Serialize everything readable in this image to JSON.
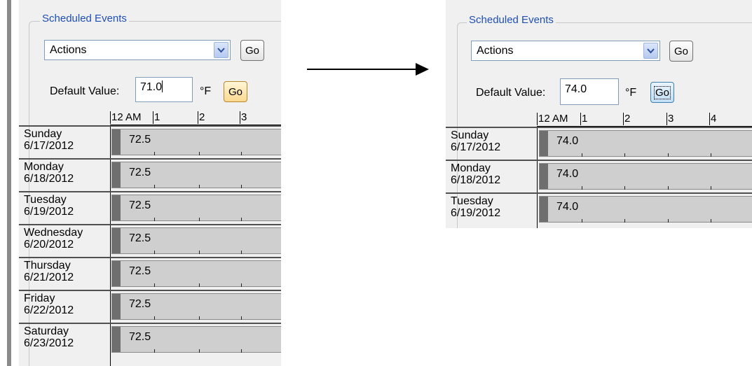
{
  "left_panel": {
    "group_title": "Scheduled Events",
    "actions_select_value": "Actions",
    "go_top_label": "Go",
    "default_value_label": "Default Value:",
    "default_value_input": "71.0",
    "unit_label": "°F",
    "go_default_label": "Go",
    "hour_ticks": [
      "12 AM",
      "1",
      "2",
      "3"
    ],
    "rows": [
      {
        "day": "Sunday",
        "date": "6/17/2012",
        "value": "72.5"
      },
      {
        "day": "Monday",
        "date": "6/18/2012",
        "value": "72.5"
      },
      {
        "day": "Tuesday",
        "date": "6/19/2012",
        "value": "72.5"
      },
      {
        "day": "Wednesday",
        "date": "6/20/2012",
        "value": "72.5"
      },
      {
        "day": "Thursday",
        "date": "6/21/2012",
        "value": "72.5"
      },
      {
        "day": "Friday",
        "date": "6/22/2012",
        "value": "72.5"
      },
      {
        "day": "Saturday",
        "date": "6/23/2012",
        "value": "72.5"
      }
    ]
  },
  "right_panel": {
    "group_title": "Scheduled Events",
    "actions_select_value": "Actions",
    "go_top_label": "Go",
    "default_value_label": "Default Value:",
    "default_value_input": "74.0",
    "unit_label": "°F",
    "go_default_label": "Go",
    "hour_ticks": [
      "12 AM",
      "1",
      "2",
      "3",
      "4"
    ],
    "rows": [
      {
        "day": "Sunday",
        "date": "6/17/2012",
        "value": "74.0"
      },
      {
        "day": "Monday",
        "date": "6/18/2012",
        "value": "74.0"
      },
      {
        "day": "Tuesday",
        "date": "6/19/2012",
        "value": "74.0"
      }
    ]
  },
  "colors": {
    "group_title": "#1f4fb5",
    "panel_bg": "#f0f0f0",
    "bar_fill": "#cfcfcf",
    "bar_handle": "#6f6f6f",
    "go_hot": "#fbd88f",
    "go_focus": "#c2def5"
  },
  "icons": {
    "dropdown": "chevron-down-icon",
    "arrow": "right-arrow-icon"
  }
}
